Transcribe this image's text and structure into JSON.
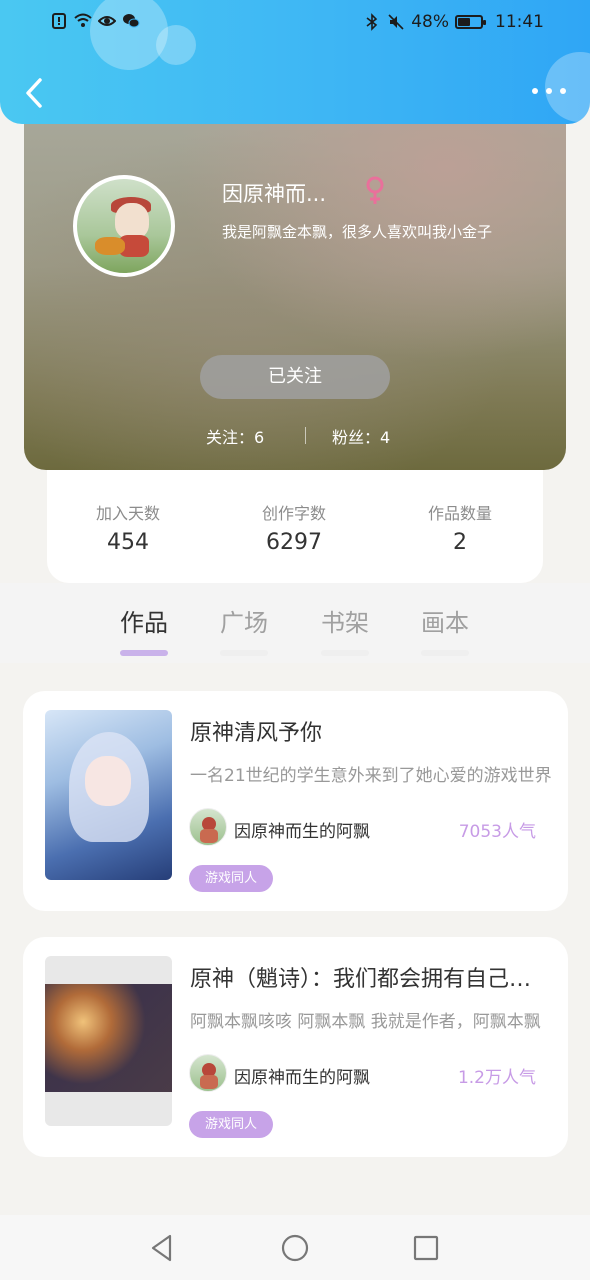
{
  "status_bar": {
    "battery_percent": "48%",
    "battery_level": 0.48,
    "time": "11:41",
    "icons_left": [
      "alert-icon",
      "wifi-icon",
      "eye-icon",
      "wechat-icon"
    ],
    "icons_right": [
      "bluetooth-icon",
      "mute-icon",
      "battery-icon"
    ]
  },
  "header": {
    "back_icon": "chevron-left-icon",
    "more_icon": "more-dots-icon",
    "gradient": [
      "#4ac8f2",
      "#2fa6f5"
    ]
  },
  "profile": {
    "username": "因原神而...",
    "gender_icon": "female-icon",
    "gender_color": "#e9709b",
    "bio": "我是阿飘金本飘，很多人喜欢叫我小金子",
    "follow_button": "已关注",
    "following": "关注：6",
    "fans": "粉丝：4"
  },
  "stats": [
    {
      "label": "加入天数",
      "value": "454"
    },
    {
      "label": "创作字数",
      "value": "6297"
    },
    {
      "label": "作品数量",
      "value": "2"
    }
  ],
  "tabs": [
    {
      "label": "作品",
      "active": true
    },
    {
      "label": "广场",
      "active": false
    },
    {
      "label": "书架",
      "active": false
    },
    {
      "label": "画本",
      "active": false
    }
  ],
  "works": [
    {
      "title": "原神清风予你",
      "description": "一名21世纪的学生意外来到了她心爱的游戏世界",
      "author": "因原神而生的阿飘",
      "popularity": "7053人气",
      "tag": "游戏同人"
    },
    {
      "title": "原神（魈诗）：我们都会拥有自己的结局",
      "description": "阿飘本飘咳咳 阿飘本飘 我就是作者，阿飘本飘",
      "author": "因原神而生的阿飘",
      "popularity": "1.2万人气",
      "tag": "游戏同人"
    }
  ],
  "colors": {
    "accent_purple": "#c7a3e8",
    "tab_indicator": "#c9b2ea",
    "popularity_text": "#c79be6"
  },
  "nav": [
    "back-triangle-icon",
    "home-circle-icon",
    "recents-square-icon"
  ]
}
